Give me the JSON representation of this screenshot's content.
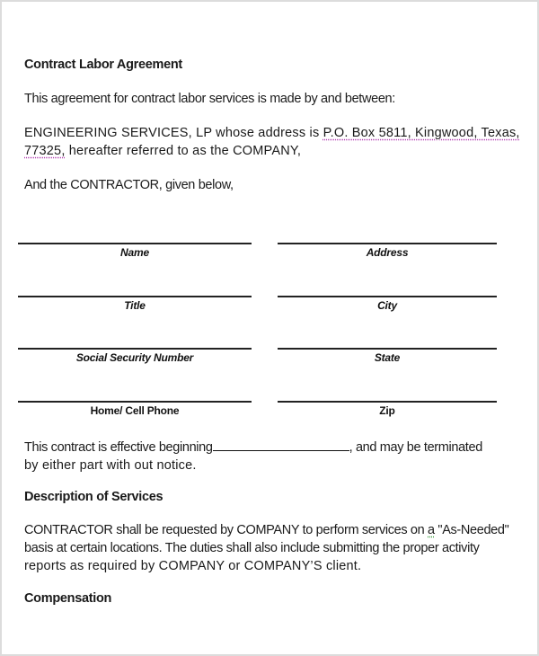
{
  "document": {
    "title": "Contract Labor Agreement",
    "intro": "This agreement for contract labor services is made by and between:",
    "company_paragraph": {
      "line1_prefix": "ENGINEERING SERVICES, LP whose address is ",
      "line1_address": "P.O. Box 5811, Kingwood, Texas,",
      "line2_zip": "77325,",
      "line2_rest": " hereafter referred to as the COMPANY,"
    },
    "contractor_intro": "And the CONTRACTOR, given below,",
    "fields": {
      "left": [
        {
          "label": "Name",
          "italic": true
        },
        {
          "label": "Title",
          "italic": true
        },
        {
          "label": "Social Security Number",
          "italic": true
        },
        {
          "label": "Home/ Cell Phone",
          "italic": false
        }
      ],
      "right": [
        {
          "label": "Address",
          "italic": true
        },
        {
          "label": "City",
          "italic": true
        },
        {
          "label": "State",
          "italic": true
        },
        {
          "label": "Zip",
          "italic": false
        }
      ]
    },
    "effective": {
      "prefix": "This contract is effective beginning",
      "suffix": ", and may be terminated",
      "line2": "by either part with out notice."
    },
    "services": {
      "heading": "Description of Services",
      "line1_prefix": "CONTRACTOR shall be requested by COMPANY to perform services on ",
      "line1_flagged": "a",
      "line1_suffix": " \"As-Needed\"",
      "line2": "basis at certain locations.  The duties shall also include submitting the proper activity",
      "line3": "reports as required by COMPANY or COMPANY’S client."
    },
    "compensation": {
      "heading": "Compensation"
    }
  }
}
